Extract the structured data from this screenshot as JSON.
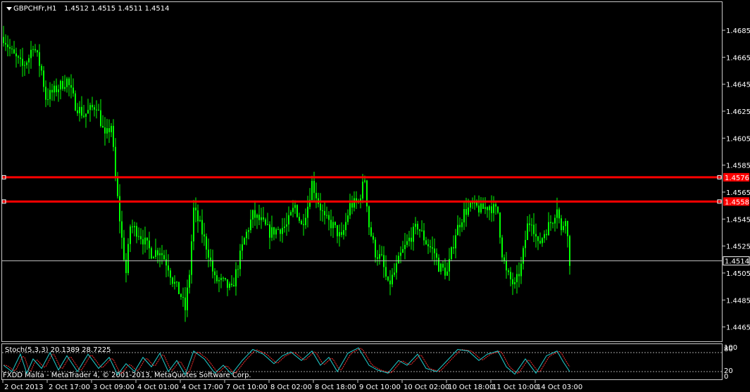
{
  "header": {
    "symbol_text": "GBPCHFr,H1",
    "ohlc_text": "1.4512 1.4515 1.4511 1.4514"
  },
  "stoch": {
    "label": "Stoch(5,3,3) 20.1389 28.7225",
    "levels": [
      80,
      20
    ],
    "axis_labels": [
      "100",
      "80",
      "20",
      "0"
    ],
    "main_color": "#20d0d0",
    "signal_color": "#ff3030"
  },
  "copyright": "FXDD Malta - MetaTrader 4, © 2001-2013, MetaQuotes Software Corp.",
  "colors": {
    "background": "#000000",
    "candles": "#00ff00",
    "levels": "#ff0000",
    "bid_line": "#c0c0c0",
    "frame": "#c8c8c8"
  },
  "chart_data": {
    "type": "candlestick",
    "timeframe": "H1",
    "ylim": [
      1.4458,
      1.4697
    ],
    "y_ticks": [
      "1.4685",
      "1.4665",
      "1.4645",
      "1.4625",
      "1.4605",
      "1.4585",
      "1.4565",
      "1.4545",
      "1.4525",
      "1.4505",
      "1.4485",
      "1.4465"
    ],
    "x_ticks": [
      "2 Oct 2013",
      "2 Oct 17:00",
      "3 Oct 09:00",
      "4 Oct 01:00",
      "4 Oct 17:00",
      "7 Oct 10:00",
      "8 Oct 02:00",
      "8 Oct 18:00",
      "9 Oct 10:00",
      "10 Oct 02:00",
      "10 Oct 18:00",
      "11 Oct 10:00",
      "14 Oct 03:00"
    ],
    "horizontal_levels": [
      {
        "value": 1.4576,
        "label": "1.4576"
      },
      {
        "value": 1.4558,
        "label": "1.4558"
      }
    ],
    "bid_price": {
      "value": 1.4514,
      "label": "1.4514"
    },
    "close_anchors": [
      [
        0,
        1.468
      ],
      [
        4,
        1.4668
      ],
      [
        9,
        1.4658
      ],
      [
        12,
        1.4665
      ],
      [
        14,
        1.4675
      ],
      [
        18,
        1.4655
      ],
      [
        20,
        1.4635
      ],
      [
        24,
        1.464
      ],
      [
        30,
        1.4648
      ],
      [
        34,
        1.463
      ],
      [
        38,
        1.4622
      ],
      [
        44,
        1.463
      ],
      [
        48,
        1.4605
      ],
      [
        51,
        1.4615
      ],
      [
        53,
        1.4575
      ],
      [
        56,
        1.453
      ],
      [
        58,
        1.4505
      ],
      [
        60,
        1.454
      ],
      [
        64,
        1.4535
      ],
      [
        70,
        1.452
      ],
      [
        74,
        1.4522
      ],
      [
        78,
        1.451
      ],
      [
        80,
        1.45
      ],
      [
        84,
        1.4488
      ],
      [
        86,
        1.4478
      ],
      [
        88,
        1.4505
      ],
      [
        90,
        1.4552
      ],
      [
        93,
        1.454
      ],
      [
        97,
        1.452
      ],
      [
        100,
        1.45
      ],
      [
        104,
        1.4498
      ],
      [
        108,
        1.4492
      ],
      [
        110,
        1.4505
      ],
      [
        114,
        1.453
      ],
      [
        118,
        1.4548
      ],
      [
        122,
        1.4543
      ],
      [
        126,
        1.4535
      ],
      [
        134,
        1.454
      ],
      [
        138,
        1.4555
      ],
      [
        141,
        1.454
      ],
      [
        144,
        1.4555
      ],
      [
        146,
        1.4572
      ],
      [
        149,
        1.4558
      ],
      [
        152,
        1.4545
      ],
      [
        156,
        1.454
      ],
      [
        160,
        1.453
      ],
      [
        164,
        1.4555
      ],
      [
        168,
        1.4558
      ],
      [
        171,
        1.4575
      ],
      [
        173,
        1.454
      ],
      [
        176,
        1.452
      ],
      [
        179,
        1.4515
      ],
      [
        182,
        1.4495
      ],
      [
        185,
        1.4505
      ],
      [
        188,
        1.4518
      ],
      [
        192,
        1.453
      ],
      [
        196,
        1.454
      ],
      [
        200,
        1.4528
      ],
      [
        204,
        1.452
      ],
      [
        206,
        1.451
      ],
      [
        210,
        1.4505
      ],
      [
        214,
        1.4535
      ],
      [
        218,
        1.455
      ],
      [
        222,
        1.4555
      ],
      [
        226,
        1.4552
      ],
      [
        230,
        1.4555
      ],
      [
        234,
        1.455
      ],
      [
        236,
        1.452
      ],
      [
        238,
        1.4505
      ],
      [
        242,
        1.4495
      ],
      [
        245,
        1.451
      ],
      [
        248,
        1.454
      ],
      [
        250,
        1.4545
      ],
      [
        253,
        1.4525
      ],
      [
        256,
        1.4535
      ],
      [
        260,
        1.4545
      ],
      [
        262,
        1.4555
      ],
      [
        264,
        1.4535
      ],
      [
        266,
        1.4548
      ],
      [
        268,
        1.4514
      ]
    ],
    "stoch_anchors": [
      [
        0,
        40
      ],
      [
        4,
        20
      ],
      [
        8,
        75
      ],
      [
        11,
        15
      ],
      [
        14,
        60
      ],
      [
        18,
        30
      ],
      [
        22,
        80
      ],
      [
        26,
        25
      ],
      [
        30,
        70
      ],
      [
        35,
        20
      ],
      [
        40,
        75
      ],
      [
        45,
        30
      ],
      [
        50,
        65
      ],
      [
        54,
        10
      ],
      [
        58,
        45
      ],
      [
        62,
        20
      ],
      [
        66,
        65
      ],
      [
        70,
        35
      ],
      [
        74,
        78
      ],
      [
        78,
        20
      ],
      [
        82,
        55
      ],
      [
        86,
        10
      ],
      [
        90,
        85
      ],
      [
        95,
        60
      ],
      [
        100,
        15
      ],
      [
        104,
        40
      ],
      [
        108,
        12
      ],
      [
        113,
        55
      ],
      [
        118,
        90
      ],
      [
        123,
        75
      ],
      [
        128,
        45
      ],
      [
        132,
        70
      ],
      [
        136,
        82
      ],
      [
        141,
        55
      ],
      [
        146,
        85
      ],
      [
        150,
        40
      ],
      [
        154,
        65
      ],
      [
        158,
        20
      ],
      [
        163,
        78
      ],
      [
        168,
        95
      ],
      [
        173,
        40
      ],
      [
        177,
        25
      ],
      [
        182,
        15
      ],
      [
        187,
        55
      ],
      [
        191,
        40
      ],
      [
        196,
        75
      ],
      [
        200,
        30
      ],
      [
        205,
        20
      ],
      [
        210,
        55
      ],
      [
        215,
        90
      ],
      [
        220,
        85
      ],
      [
        225,
        55
      ],
      [
        229,
        75
      ],
      [
        234,
        85
      ],
      [
        238,
        35
      ],
      [
        242,
        12
      ],
      [
        247,
        60
      ],
      [
        252,
        15
      ],
      [
        257,
        70
      ],
      [
        262,
        85
      ],
      [
        265,
        50
      ],
      [
        268,
        20
      ]
    ]
  }
}
